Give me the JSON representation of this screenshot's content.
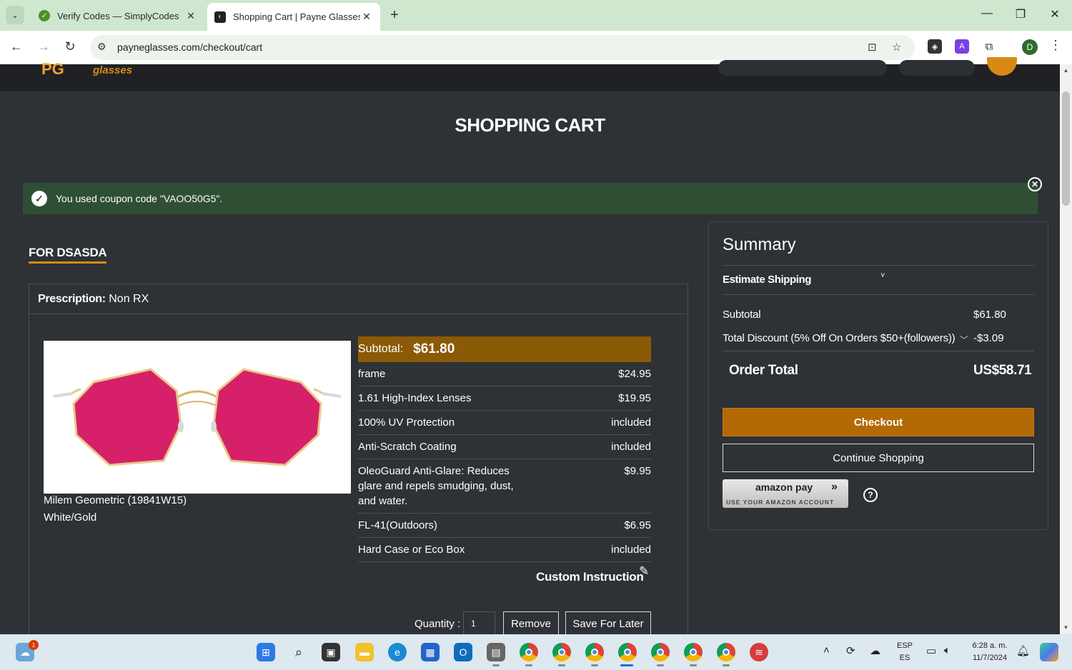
{
  "browser": {
    "tabs": [
      {
        "title": "Verify Codes — SimplyCodes",
        "active": false
      },
      {
        "title": "Shopping Cart | Payne Glasses",
        "active": true
      }
    ],
    "url": "payneglasses.com/checkout/cart",
    "profile_initial": "D"
  },
  "header": {
    "logo_mark": "PG",
    "logo_text": "glasses"
  },
  "page": {
    "title": "SHOPPING CART",
    "notice": "You used coupon code \"VAOO50G5\".",
    "for_name": "FOR DSASDA"
  },
  "item": {
    "prescription_label": "Prescription:",
    "prescription_value": "Non RX",
    "name": "Milem Geometric (19841W15)",
    "color": "White/Gold",
    "subtotal_label": "Subtotal:",
    "subtotal_value": "$61.80",
    "lines": [
      {
        "desc": "frame",
        "price": "$24.95"
      },
      {
        "desc": "1.61 High-Index Lenses",
        "price": "$19.95"
      },
      {
        "desc": "100% UV Protection",
        "price": "included"
      },
      {
        "desc": "Anti-Scratch Coating",
        "price": "included"
      },
      {
        "desc": "OleoGuard Anti-Glare: Reduces glare and repels smudging, dust, and water.",
        "price": "$9.95"
      },
      {
        "desc": "FL-41(Outdoors)",
        "price": "$6.95"
      },
      {
        "desc": "Hard Case or Eco Box",
        "price": "included"
      }
    ],
    "custom_instruction": "Custom Instruction",
    "quantity_label": "Quantity :",
    "quantity": "1",
    "remove_label": "Remove",
    "save_later_label": "Save For Later"
  },
  "summary": {
    "title": "Summary",
    "estimate_shipping": "Estimate Shipping",
    "subtotal_label": "Subtotal",
    "subtotal_value": "$61.80",
    "discount_label": "Total Discount (5% Off On Orders $50+(followers))",
    "discount_value": "-$3.09",
    "order_total_label": "Order Total",
    "order_total_value": "US$58.71",
    "checkout_label": "Checkout",
    "continue_label": "Continue Shopping",
    "amazon_pay_label": "amazon pay",
    "amazon_pay_sub": "USE YOUR AMAZON ACCOUNT"
  },
  "taskbar": {
    "lang_top": "ESP",
    "lang_bottom": "ES",
    "time": "6:28 a. m.",
    "date": "11/7/2024"
  },
  "colors": {
    "accent": "#d98a14",
    "subtotal_bar": "#8a5a07",
    "checkout": "#b36a05",
    "notice_bg": "#2f4f34",
    "page_bg": "#2e3135",
    "lens": "#d6206a"
  }
}
